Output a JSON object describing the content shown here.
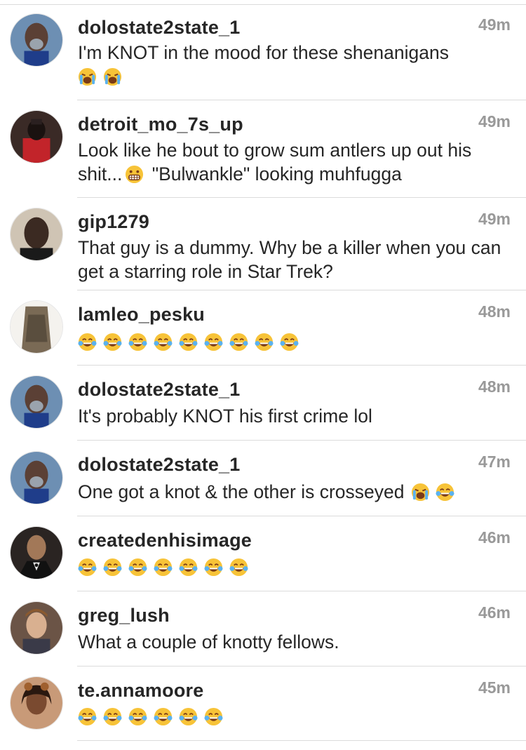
{
  "comments": [
    {
      "username": "dolostate2state_1",
      "time": "49m",
      "text": "I'm KNOT in the mood for these shenanigans",
      "text_after": "",
      "emojis": [
        "crying",
        "crying"
      ],
      "avatar_bg": "#6d8fb3"
    },
    {
      "username": "detroit_mo_7s_up",
      "time": "49m",
      "text": "Look like he bout to grow sum antlers up out his shit...",
      "text_after": " \"Bulwankle\" looking muhfugga",
      "emojis": [
        "grimace"
      ],
      "avatar_bg": "#3a2a26"
    },
    {
      "username": "gip1279",
      "time": "49m",
      "text": "That guy is a dummy. Why be a killer when you can get a starring role in Star Trek?",
      "text_after": "",
      "emojis": [],
      "avatar_bg": "#5a4a3e"
    },
    {
      "username": "lamleo_pesku",
      "time": "48m",
      "text": "",
      "text_after": "",
      "emojis": [
        "joy",
        "joy",
        "joy",
        "joy",
        "joy",
        "joy",
        "joy",
        "joy",
        "joy"
      ],
      "avatar_bg": "#9a8d78"
    },
    {
      "username": "dolostate2state_1",
      "time": "48m",
      "text": "It's probably KNOT his first crime lol",
      "text_after": "",
      "emojis": [],
      "avatar_bg": "#6d8fb3"
    },
    {
      "username": "dolostate2state_1",
      "time": "47m",
      "text": "One got a knot & the other is crosseyed",
      "text_after": "",
      "emojis": [
        "crying",
        "joy"
      ],
      "avatar_bg": "#6d8fb3"
    },
    {
      "username": "createdenhisimage",
      "time": "46m",
      "text": "",
      "text_after": "",
      "emojis": [
        "joy",
        "joy",
        "joy",
        "joy",
        "joy",
        "joy",
        "joy"
      ],
      "avatar_bg": "#2a2422"
    },
    {
      "username": "greg_lush",
      "time": "46m",
      "text": "What a couple of knotty fellows.",
      "text_after": "",
      "emojis": [],
      "avatar_bg": "#6b5446"
    },
    {
      "username": "te.annamoore",
      "time": "45m",
      "text": "",
      "text_after": "",
      "emojis": [
        "joy",
        "joy",
        "joy",
        "joy",
        "joy",
        "joy"
      ],
      "avatar_bg": "#c89a78"
    }
  ]
}
